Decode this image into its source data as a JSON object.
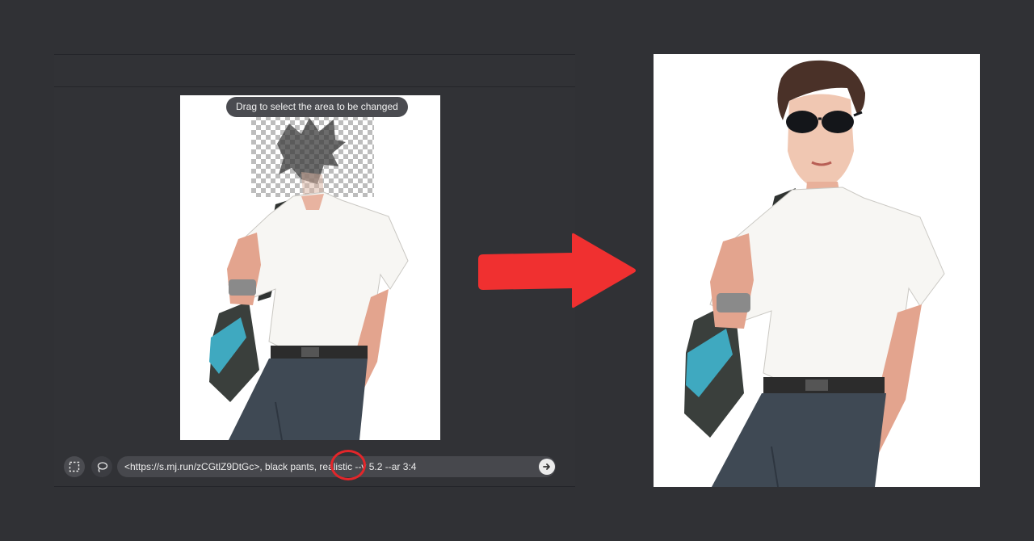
{
  "editor": {
    "tooltip": "Drag to select the area to be changed",
    "prompt": "<https://s.mj.run/zCGtlZ9DtGc>, black pants, realistic --v 5.2 --ar 3:4",
    "tools": [
      "vary-region-rectangle-icon",
      "vary-region-lasso-icon"
    ],
    "send_icon": "arrow-right-icon",
    "highlight_color": "#e3262a"
  },
  "arrow_color": "#f03030",
  "background_color": "#303135"
}
